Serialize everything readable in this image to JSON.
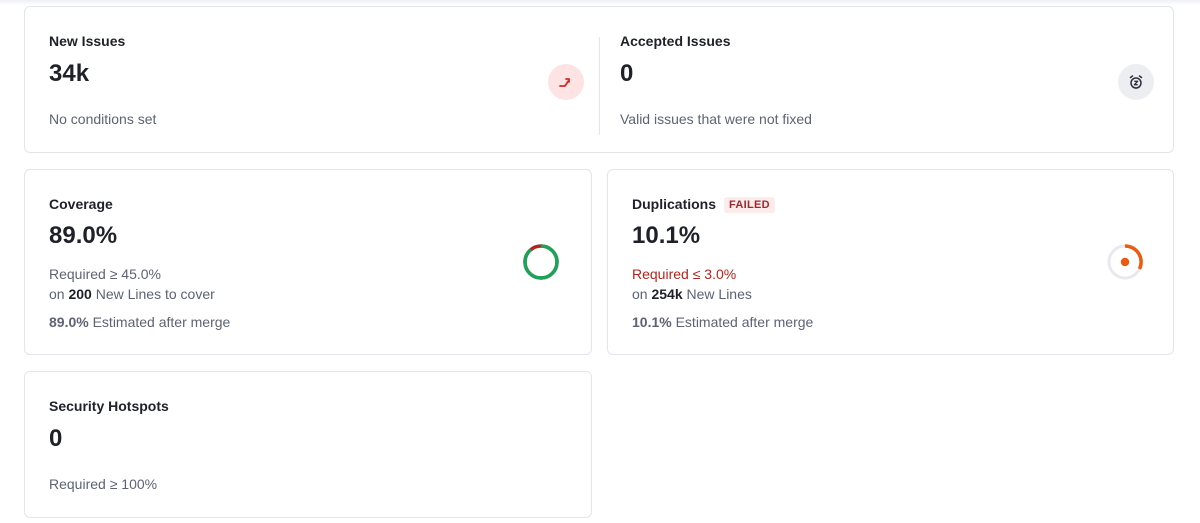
{
  "issues_panel": {
    "new_issues": {
      "label": "New Issues",
      "value": "34k",
      "note": "No conditions set",
      "icon": "trend-up-icon"
    },
    "accepted_issues": {
      "label": "Accepted Issues",
      "value": "0",
      "note": "Valid issues that were not fixed",
      "icon": "alarm-clock-icon"
    }
  },
  "coverage": {
    "label": "Coverage",
    "value": "89.0%",
    "required": "Required ≥ 45.0%",
    "lines_prefix": "on",
    "lines_count": "200",
    "lines_suffix": "New Lines to cover",
    "estimate_value": "89.0%",
    "estimate_suffix": "Estimated after merge",
    "gauge_fraction": 0.89,
    "colors": {
      "covered": "#19a45a",
      "uncovered": "#b3261e"
    }
  },
  "duplications": {
    "label": "Duplications",
    "status": "FAILED",
    "value": "10.1%",
    "required": "Required ≤ 3.0%",
    "lines_prefix": "on",
    "lines_count": "254k",
    "lines_suffix": "New Lines",
    "estimate_value": "10.1%",
    "estimate_suffix": "Estimated after merge",
    "colors": {
      "accent": "#ec5a0f",
      "track": "#e8e9ee"
    }
  },
  "security_hotspots": {
    "label": "Security Hotspots",
    "value": "0",
    "required": "Required ≥ 100%"
  }
}
